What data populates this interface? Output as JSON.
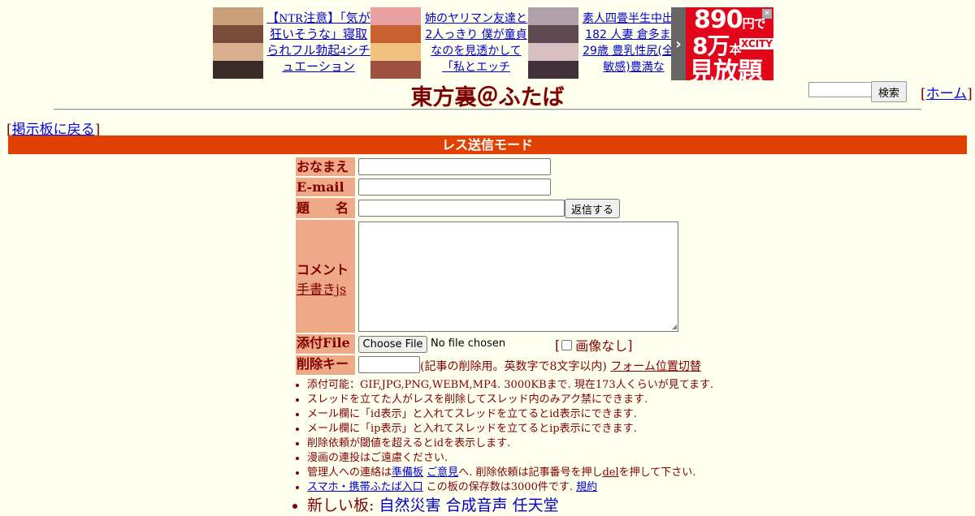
{
  "ads": [
    {
      "text": "【NTR注意】「気が狂いそうな」寝取られフル勃起4シチュエーション",
      "thumb_colors": [
        "#c9a07a",
        "#7a4b3a",
        "#d8b090",
        "#3a2a2a"
      ]
    },
    {
      "text": "姉のヤリマン友達と2人っきり 僕が童貞なのを見透かして「私とエッチ",
      "thumb_colors": [
        "#e8a0a0",
        "#c86030",
        "#f0c080",
        "#a05040"
      ]
    },
    {
      "text": "素人四畳半生中出し182 人妻 倉多まお 29歳 豊乳性尻(全身敏感)豊満な",
      "thumb_colors": [
        "#b0a0a8",
        "#604850",
        "#d8c0c0",
        "#403038"
      ]
    }
  ],
  "ad_banner": {
    "arrow": "›",
    "price": "890",
    "price_unit": "円で",
    "count": "8万",
    "count_unit": "本",
    "brand": "XCITY",
    "unlimited": "見放題",
    "corner": "✕"
  },
  "header": {
    "title": "東方裏＠ふたば",
    "search_button": "検索",
    "home_link": "ホーム"
  },
  "nav": {
    "back_link": "掲示板に戻る"
  },
  "mode_bar": "レス送信モード",
  "form": {
    "name_label": "おなまえ",
    "email_label": "E-mail",
    "subject_label": "題　　名",
    "submit_button": "返信する",
    "comment_label": "コメント",
    "tegaki_link": "手書きjs",
    "file_label": "添付File",
    "choose_file_button": "Choose File",
    "file_status": "No file chosen",
    "no_image_label": "画像なし",
    "delkey_label": "削除キー",
    "delkey_note": "(記事の削除用。英数字で8文字以内)",
    "form_switch_link": "フォーム位置切替"
  },
  "notes": [
    {
      "text": "添付可能：GIF,JPG,PNG,WEBM,MP4. 3000KBまで. 現在173人くらいが見てます."
    },
    {
      "text": "スレッドを立てた人がレスを削除してスレッド内のみアク禁にできます."
    },
    {
      "text": "メール欄に「id表示」と入れてスレッドを立てるとid表示にできます."
    },
    {
      "text": "メール欄に「ip表示」と入れてスレッドを立てるとip表示にできます."
    },
    {
      "text": "削除依頼が閾値を超えるとidを表示します."
    },
    {
      "text": "漫画の連投はご遠慮ください."
    }
  ],
  "note_contact": {
    "pre": "管理人への連絡は",
    "link1": "準備板",
    "link2": "ご意見",
    "mid": "へ. 削除依頼は記事番号を押し",
    "del_link": "del",
    "post": "を押して下さい."
  },
  "note_mobile": {
    "link": "スマホ・携帯ふたば入口",
    "text": "この板の保存数は3000件です.",
    "rules_link": "規約"
  },
  "note_new_boards": {
    "label": "新しい板:",
    "boards": [
      "自然災害",
      "合成音声",
      "任天堂"
    ]
  }
}
